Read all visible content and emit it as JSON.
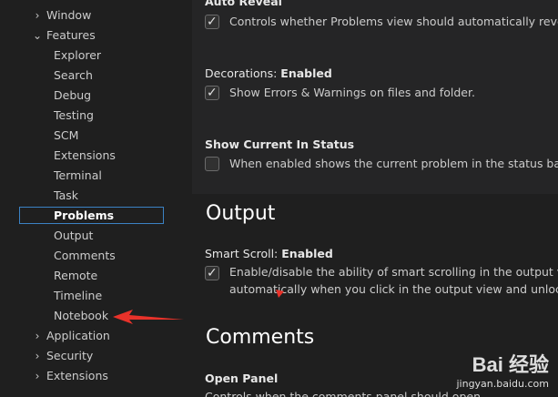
{
  "tree": {
    "window": "Window",
    "features": "Features",
    "children": [
      "Explorer",
      "Search",
      "Debug",
      "Testing",
      "SCM",
      "Extensions",
      "Terminal",
      "Task",
      "Problems",
      "Output",
      "Comments",
      "Remote",
      "Timeline",
      "Notebook"
    ],
    "application": "Application",
    "security": "Security",
    "extensions": "Extensions"
  },
  "settings": {
    "auto_reveal_title": "Auto Reveal",
    "auto_reveal_desc": "Controls whether Problems view should automatically reveal fil",
    "decorations_label": "Decorations: ",
    "decorations_value": "Enabled",
    "decorations_desc": "Show Errors & Warnings on files and folder.",
    "show_current_title": "Show Current In Status",
    "show_current_desc": "When enabled shows the current problem in the status bar.",
    "output_heading": "Output",
    "smart_scroll_label": "Smart Scroll: ",
    "smart_scroll_value": "Enabled",
    "smart_scroll_desc1": "Enable/disable the ability of smart scrolling in the output view.",
    "smart_scroll_desc2": "automatically when you click in the output view and unlocks wh",
    "comments_heading": "Comments",
    "open_panel_title": "Open Panel",
    "open_panel_desc": "Controls when the comments panel should open."
  },
  "checkmark": "✓",
  "watermark": {
    "logo": "Bai 经验",
    "sub": "jingyan.baidu.com"
  },
  "colors": {
    "selection_border": "#3b82c4",
    "arrow": "#e8322a"
  }
}
